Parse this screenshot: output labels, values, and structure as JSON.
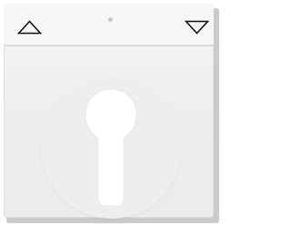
{
  "device": {
    "type": "roller-shutter key switch cover plate",
    "colors": {
      "plate": "#eeefef",
      "shadow": "#c9cacb",
      "disc": "#eeeeef",
      "cylinder_opening": "#ffffff",
      "symbol_stroke": "#111111",
      "indicator_dot": "#c7c7c7"
    },
    "icons": {
      "left": "arrow-up-icon",
      "right": "arrow-down-icon",
      "center": "keyhole-icon"
    }
  }
}
